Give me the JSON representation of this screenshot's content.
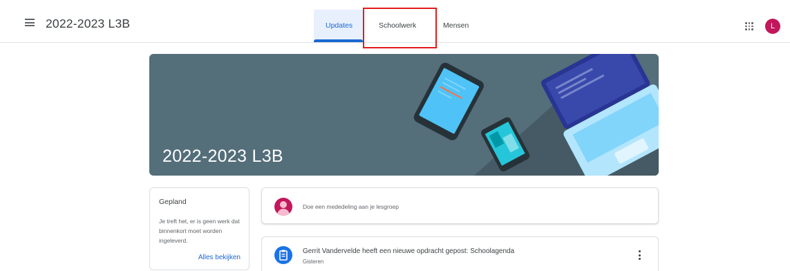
{
  "header": {
    "class_title": "2022-2023 L3B",
    "tabs": [
      {
        "label": "Updates",
        "active": true
      },
      {
        "label": "Schoolwerk",
        "active": false
      },
      {
        "label": "Mensen",
        "active": false
      }
    ],
    "avatar_initial": "L",
    "avatar_color": "#c2185b",
    "accent_color": "#1967d2",
    "highlight_color": "#e11b1b"
  },
  "banner": {
    "title": "2022-2023 L3B",
    "background_color": "#546e7a"
  },
  "upcoming": {
    "title": "Gepland",
    "text": "Je treft het, er is geen werk dat binnenkort moet worden ingeleverd.",
    "link": "Alles bekijken"
  },
  "announce": {
    "placeholder": "Doe een mededeling aan je lesgroep"
  },
  "posts": [
    {
      "title": "Gerrit Vandervelde heeft een nieuwe opdracht gepost: Schoolagenda",
      "date": "Gisteren",
      "icon": "assignment-icon"
    }
  ]
}
